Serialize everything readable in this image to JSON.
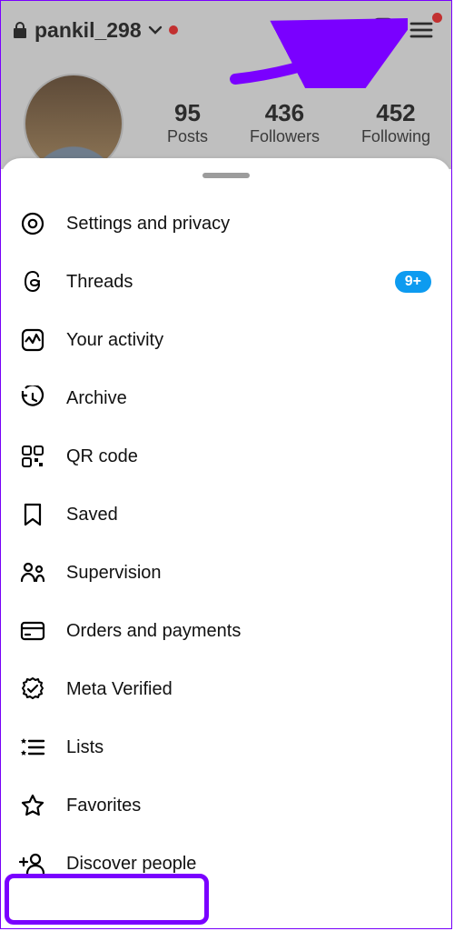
{
  "header": {
    "username": "pankil_298"
  },
  "stats": {
    "posts": {
      "count": "95",
      "label": "Posts"
    },
    "followers": {
      "count": "436",
      "label": "Followers"
    },
    "following": {
      "count": "452",
      "label": "Following"
    }
  },
  "menu": {
    "settings": "Settings and privacy",
    "threads": {
      "label": "Threads",
      "badge": "9+"
    },
    "activity": "Your activity",
    "archive": "Archive",
    "qr": "QR code",
    "saved": "Saved",
    "supervision": "Supervision",
    "orders": "Orders and payments",
    "verified": "Meta Verified",
    "lists": "Lists",
    "favorites": "Favorites",
    "discover": "Discover people"
  }
}
